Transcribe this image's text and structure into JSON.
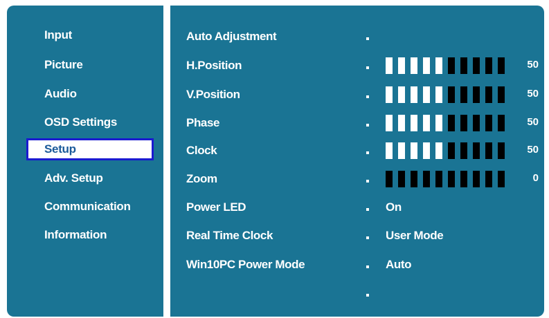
{
  "menu": {
    "items": [
      {
        "label": "Input",
        "selected": false
      },
      {
        "label": "Picture",
        "selected": false
      },
      {
        "label": "Audio",
        "selected": false
      },
      {
        "label": "OSD Settings",
        "selected": false
      },
      {
        "label": "Setup",
        "selected": true
      },
      {
        "label": "Adv. Setup",
        "selected": false
      },
      {
        "label": "Communication",
        "selected": false
      },
      {
        "label": "Information",
        "selected": false
      }
    ]
  },
  "settings": {
    "rows": [
      {
        "label": "Auto Adjustment",
        "type": "action"
      },
      {
        "label": "H.Position",
        "type": "slider",
        "value": "50",
        "filled_fraction": 0.5
      },
      {
        "label": "V.Position",
        "type": "slider",
        "value": "50",
        "filled_fraction": 0.5
      },
      {
        "label": "Phase",
        "type": "slider",
        "value": "50",
        "filled_fraction": 0.5
      },
      {
        "label": "Clock",
        "type": "slider",
        "value": "50",
        "filled_fraction": 0.5
      },
      {
        "label": "Zoom",
        "type": "slider",
        "value": "0",
        "filled_fraction": 0.0
      },
      {
        "label": "Power LED",
        "type": "text",
        "value": "On"
      },
      {
        "label": "Real Time Clock",
        "type": "text",
        "value": "User Mode"
      },
      {
        "label": "Win10PC Power Mode",
        "type": "text",
        "value": "Auto"
      },
      {
        "label": "",
        "type": "empty"
      }
    ]
  },
  "colors": {
    "panel_bg": "#1a7494",
    "selected_bg": "#ffffff",
    "selected_text": "#1a5a9a",
    "selected_border": "#1a1ad0",
    "bar_filled": "#ffffff",
    "bar_empty": "#000000"
  }
}
